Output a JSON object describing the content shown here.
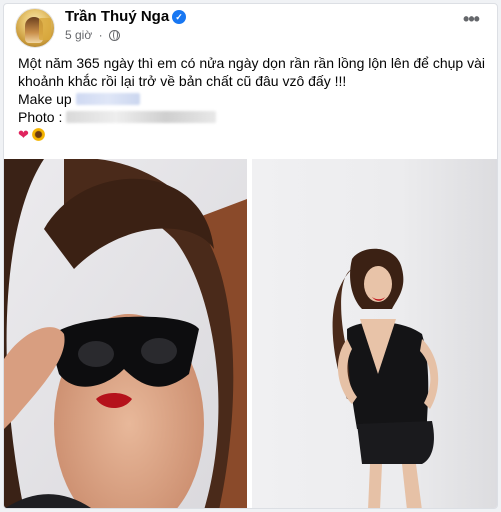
{
  "post": {
    "author": "Trần Thuý Nga",
    "time": "5 giờ",
    "separator": "·",
    "more_label": "•••",
    "verified_glyph": "✓",
    "text_line1": "Một năm 365 ngày thì em có nửa ngày dọn rần rần lồng lộn lên để chụp vài khoảnh khắc rồi lại trở về bản chất cũ đâu vzô đấy !!!",
    "makeup_label": "Make up",
    "photo_label": "Photo :",
    "emojis": [
      "heart",
      "sunflower"
    ],
    "heart_glyph": "❤"
  },
  "icons": {
    "verified": "verified-badge-icon",
    "globe": "public-globe-icon",
    "more": "more-options-icon"
  },
  "colors": {
    "verified": "#1877f2",
    "meta": "#65676b",
    "heart": "#e0245e"
  }
}
